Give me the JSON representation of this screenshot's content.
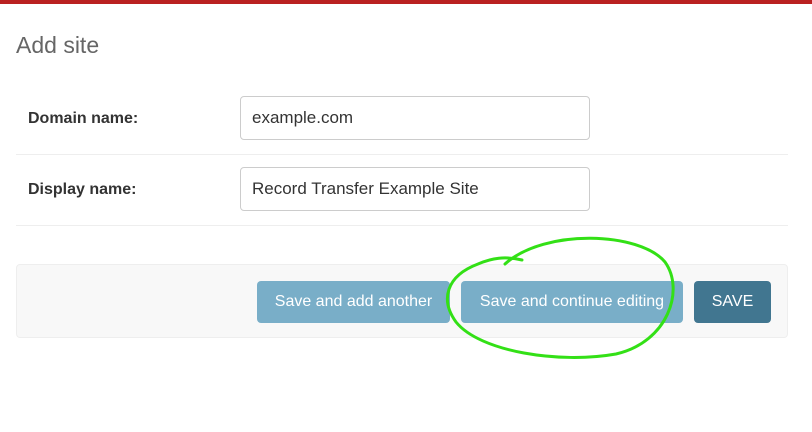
{
  "colors": {
    "header_bar": "#ba2121",
    "button_light": "#79aec8",
    "button_primary": "#417690",
    "annotation_stroke": "#33e016"
  },
  "page": {
    "title": "Add site"
  },
  "form": {
    "domain": {
      "label": "Domain name:",
      "value": "example.com"
    },
    "display": {
      "label": "Display name:",
      "value": "Record Transfer Example Site"
    }
  },
  "actions": {
    "save_add_another": "Save and add another",
    "save_continue": "Save and continue editing",
    "save": "SAVE"
  }
}
